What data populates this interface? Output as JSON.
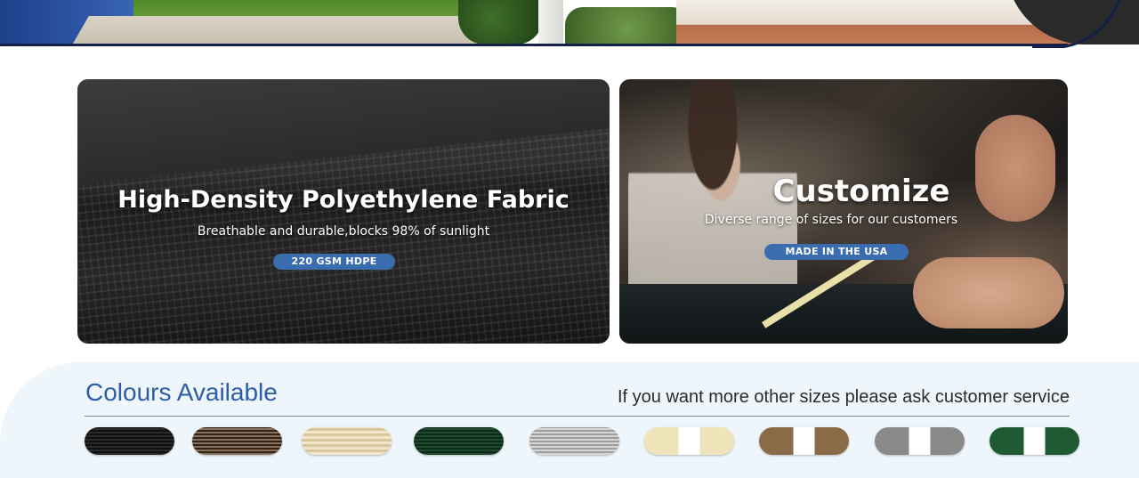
{
  "cards": [
    {
      "title": "High-Density Polyethylene Fabric",
      "subtitle": "Breathable and durable,blocks 98% of sunlight",
      "badge": "220 GSM HDPE"
    },
    {
      "title": "Customize",
      "subtitle": "Diverse range of sizes for our customers",
      "badge": "MADE IN THE USA"
    }
  ],
  "colours": {
    "title": "Colours Available",
    "note": "If you want more other sizes please ask customer service",
    "accent": "#2e5da8",
    "badge_color": "#3a6cb0",
    "swatches": [
      {
        "name": "black",
        "color": "#1a1a1a"
      },
      {
        "name": "brown",
        "color": "#5a4636"
      },
      {
        "name": "beige",
        "color": "#e6d8b2"
      },
      {
        "name": "green",
        "color": "#173d25"
      },
      {
        "name": "grey",
        "color": "#b5b5b5"
      },
      {
        "name": "beige-white",
        "color": "#efe4b9"
      },
      {
        "name": "brown-white",
        "color": "#8b6a47"
      },
      {
        "name": "grey-white",
        "color": "#8a8a8a"
      },
      {
        "name": "green-white",
        "color": "#1e5a32"
      }
    ]
  }
}
